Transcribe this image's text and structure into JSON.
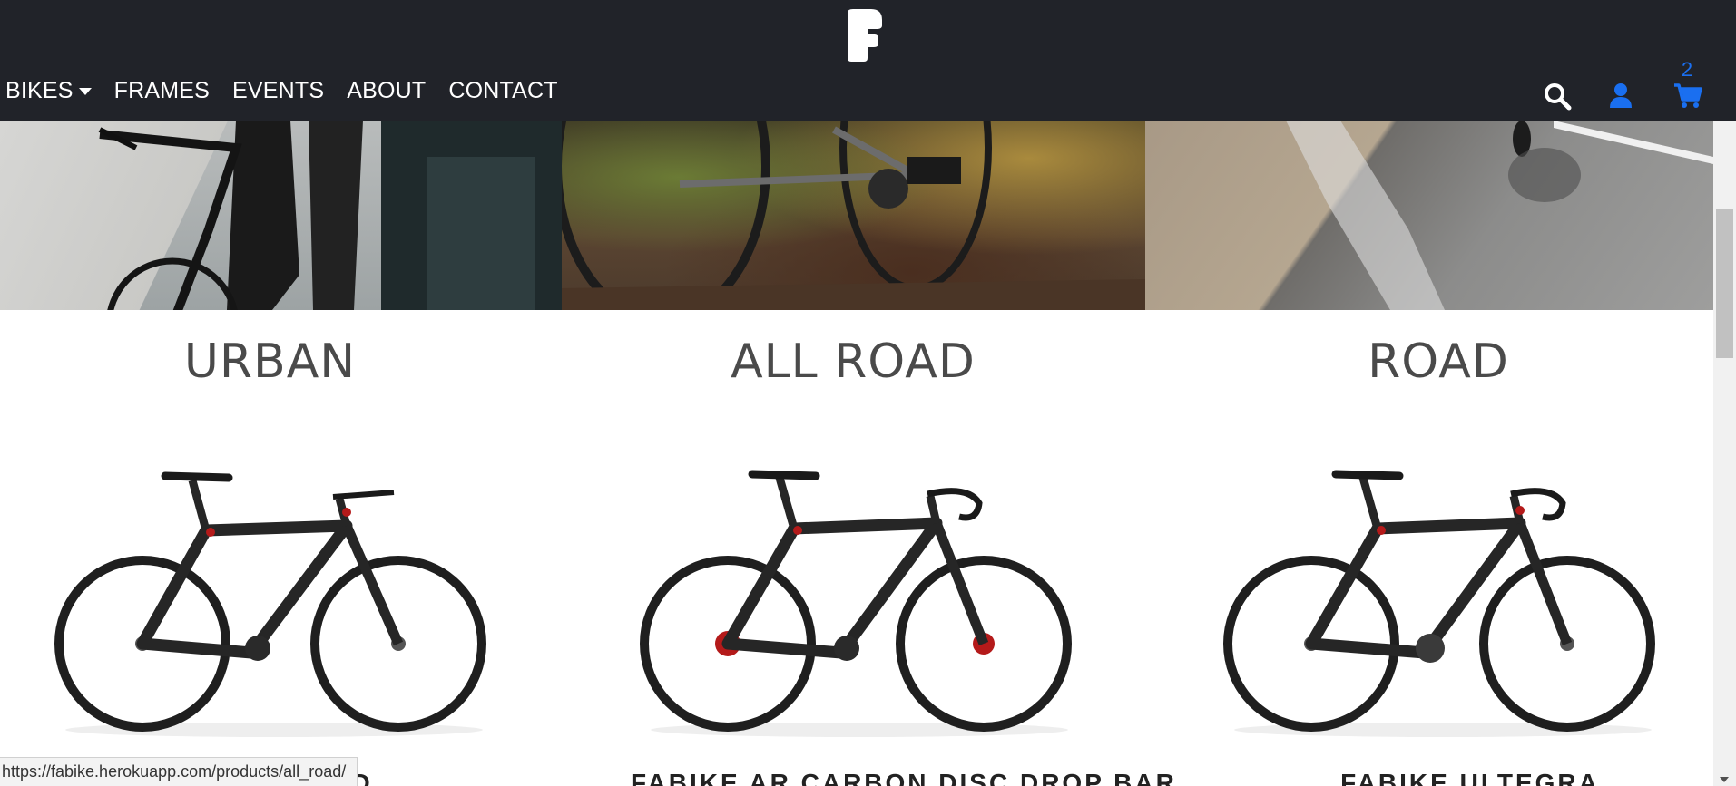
{
  "nav": {
    "links": [
      {
        "label": "BIKES",
        "dropdown": true
      },
      {
        "label": "FRAMES",
        "dropdown": false
      },
      {
        "label": "EVENTS",
        "dropdown": false
      },
      {
        "label": "ABOUT",
        "dropdown": false
      },
      {
        "label": "CONTACT",
        "dropdown": false
      }
    ],
    "cart_count": "2",
    "icons": [
      "search-icon",
      "user-icon",
      "cart-icon"
    ],
    "accent_color": "#1a6ff0",
    "background_color": "#212329"
  },
  "categories": [
    {
      "title": "URBAN",
      "product_name": "FABIKE SPEED"
    },
    {
      "title": "ALL ROAD",
      "product_name": "FABIKE AR CARBON DISC DROP BAR"
    },
    {
      "title": "ROAD",
      "product_name": "FABIKE ULTEGRA"
    }
  ],
  "status_bar": {
    "url": "https://fabike.herokuapp.com/products/all_road/"
  }
}
